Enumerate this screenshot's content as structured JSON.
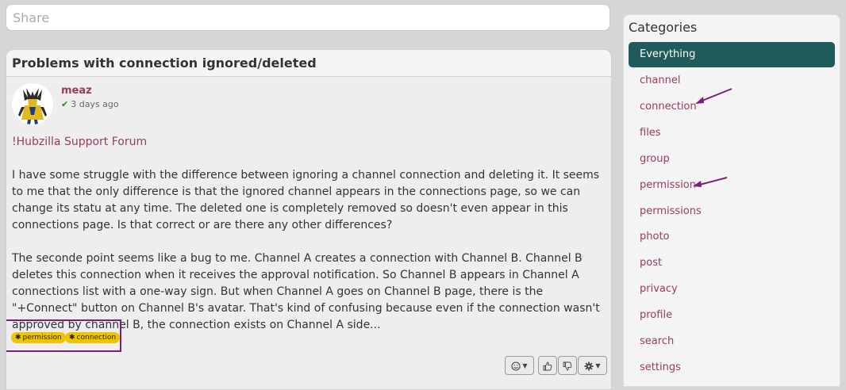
{
  "share": {
    "placeholder": "Share"
  },
  "post": {
    "title": "Problems with connection ignored/deleted",
    "author": {
      "name": "meaz",
      "time": "3 days ago"
    },
    "forum_link": "!Hubzilla Support Forum",
    "paragraphs": [
      "I have some struggle with the difference between ignoring a channel connection and deleting it. It seems to me that the only difference is that the ignored channel appears in the connections page, so we can change its statu at any time. The deleted one is completely removed so doesn't even appear in this connections page. Is that correct or are there any other differences?",
      "The seconde point seems like a bug to me. Channel A creates a connection with Channel B. Channel B deletes this connection when it receives the approval notification. So Channel B appears in Channel A connections list with a one-way sign. But when Channel A goes on Channel B page, there is the \"+Connect\" button on Channel B's avatar. That's kind of confusing because even if the connection wasn't approved by channel B, the connection exists on Channel A side..."
    ],
    "tags": [
      "permission",
      "connection"
    ],
    "tag_color": "#f0c400"
  },
  "sidebar": {
    "title": "Categories",
    "items": [
      {
        "label": "Everything",
        "active": true
      },
      {
        "label": "channel"
      },
      {
        "label": "connection"
      },
      {
        "label": "files"
      },
      {
        "label": "group"
      },
      {
        "label": "permission"
      },
      {
        "label": "permissions"
      },
      {
        "label": "photo"
      },
      {
        "label": "post"
      },
      {
        "label": "privacy"
      },
      {
        "label": "profile"
      },
      {
        "label": "search"
      },
      {
        "label": "settings"
      }
    ],
    "active_color": "#215a5a",
    "link_color": "#9a3b5c"
  },
  "icons": {
    "reactions": "smile-icon",
    "like": "thumbs-up-icon",
    "dislike": "thumbs-down-icon",
    "settings": "gear-icon",
    "verified": "check-icon"
  },
  "annotation_color": "#7a1f7a"
}
